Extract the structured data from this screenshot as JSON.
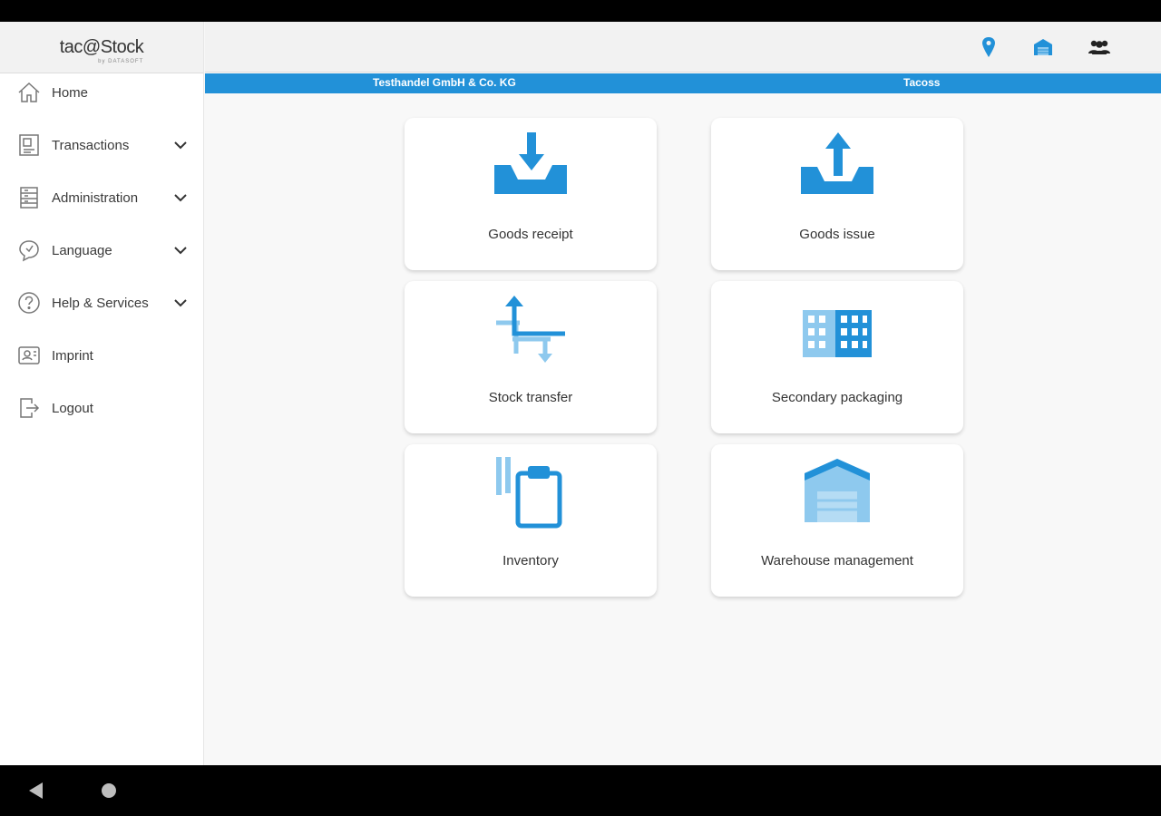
{
  "app": {
    "logo_text": "tac@Stock",
    "logo_sub": "by DATASOFT",
    "accent_color": "#2291d8",
    "light_accent_color": "#8ec9ee"
  },
  "sidebar": {
    "items": [
      {
        "label": "Home",
        "icon": "home-icon",
        "expandable": false
      },
      {
        "label": "Transactions",
        "icon": "transactions-icon",
        "expandable": true
      },
      {
        "label": "Administration",
        "icon": "administration-icon",
        "expandable": true
      },
      {
        "label": "Language",
        "icon": "language-icon",
        "expandable": true
      },
      {
        "label": "Help & Services",
        "icon": "help-icon",
        "expandable": true
      },
      {
        "label": "Imprint",
        "icon": "imprint-icon",
        "expandable": false
      },
      {
        "label": "Logout",
        "icon": "logout-icon",
        "expandable": false
      }
    ]
  },
  "header": {
    "icons": [
      "location-pin-icon",
      "warehouse-icon",
      "users-icon"
    ]
  },
  "infobar": {
    "company": "Testhandel GmbH & Co. KG",
    "user": "Tacoss"
  },
  "tiles": [
    {
      "label": "Goods receipt",
      "icon": "goods-receipt-icon"
    },
    {
      "label": "Goods issue",
      "icon": "goods-issue-icon"
    },
    {
      "label": "Stock transfer",
      "icon": "stock-transfer-icon"
    },
    {
      "label": "Secondary packaging",
      "icon": "secondary-packaging-icon"
    },
    {
      "label": "Inventory",
      "icon": "inventory-icon"
    },
    {
      "label": "Warehouse management",
      "icon": "warehouse-management-icon"
    }
  ]
}
